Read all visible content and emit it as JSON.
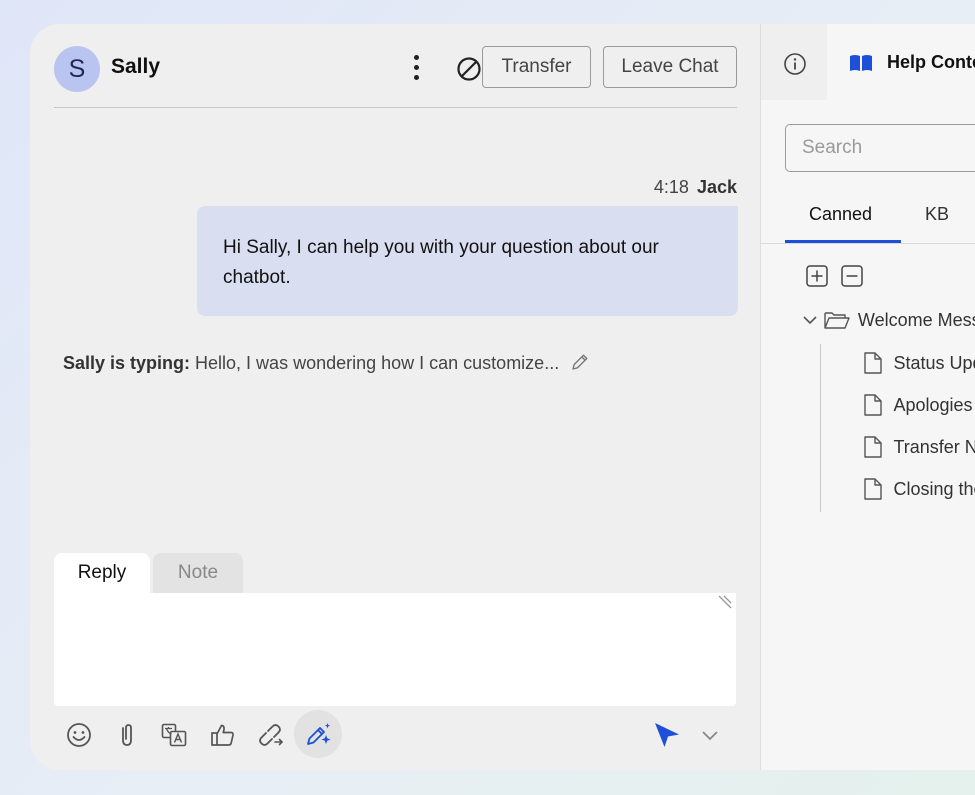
{
  "header": {
    "avatar_initial": "S",
    "contact_name": "Sally",
    "transfer_label": "Transfer",
    "leave_label": "Leave Chat"
  },
  "message": {
    "time": "4:18",
    "author": "Jack",
    "text": "Hi Sally, I can help you with your question about our chatbot."
  },
  "typing": {
    "prefix": "Sally is typing:",
    "text": " Hello,  I was wondering how I can customize..."
  },
  "composer": {
    "tabs": [
      {
        "label": "Reply"
      },
      {
        "label": "Note"
      }
    ],
    "reply_value": ""
  },
  "toolbar": {
    "icons": [
      "emoji-icon",
      "attachment-icon",
      "translate-icon",
      "thumbs-up-icon",
      "link-icon",
      "ai-compose-icon",
      "send-icon",
      "chevron-down-icon"
    ]
  },
  "side": {
    "help_label": "Help Content",
    "search_placeholder": "Search",
    "subtabs": [
      {
        "label": "Canned"
      },
      {
        "label": "KB"
      }
    ],
    "folder": "Welcome Messages",
    "items": [
      {
        "label": "Status Updates"
      },
      {
        "label": "Apologies"
      },
      {
        "label": "Transfer Notices"
      },
      {
        "label": "Closing the Chat"
      }
    ]
  },
  "colors": {
    "accent": "#1d4fd8",
    "bubble": "#d9dff0",
    "avatar": "#b9c4f1"
  }
}
